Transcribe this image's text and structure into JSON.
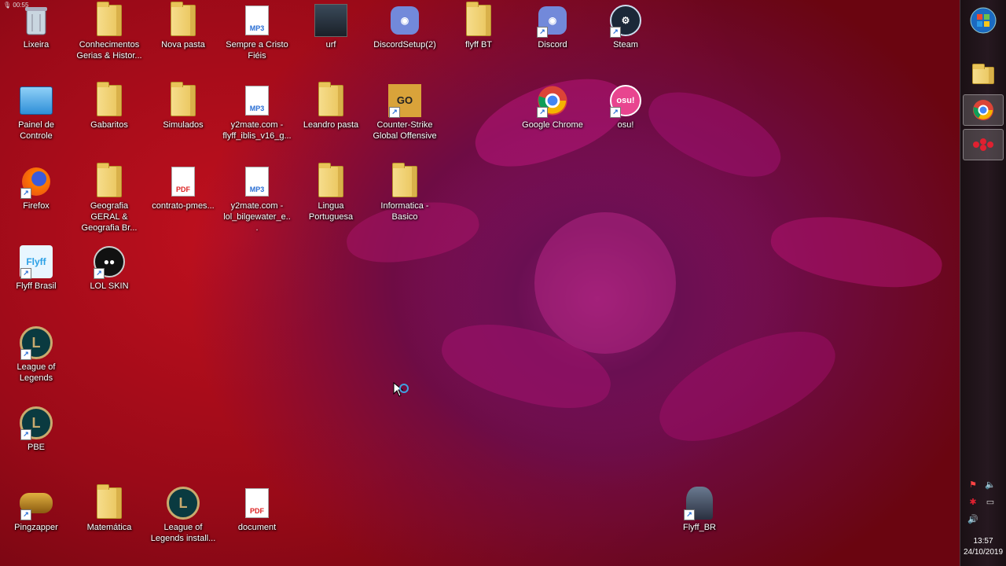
{
  "recorder": {
    "label": "00:55"
  },
  "desktop_icons": [
    {
      "name": "recycle-bin",
      "label": "Lixeira",
      "type": "bin"
    },
    {
      "name": "conhecimentos-folder",
      "label": "Conhecimentos Gerias & Histor...",
      "type": "folder"
    },
    {
      "name": "nova-pasta-folder",
      "label": "Nova pasta",
      "type": "folder"
    },
    {
      "name": "sempre-a-cristo-file",
      "label": "Sempre a Cristo Fiéis",
      "type": "mp3"
    },
    {
      "name": "urf-file",
      "label": "urf",
      "type": "image"
    },
    {
      "name": "discordsetup-file",
      "label": "DiscordSetup(2)",
      "type": "discord"
    },
    {
      "name": "flyff-bt-folder",
      "label": "flyff BT",
      "type": "folder"
    },
    {
      "name": "discord-shortcut",
      "label": "Discord",
      "type": "discord"
    },
    {
      "name": "steam-shortcut",
      "label": "Steam",
      "type": "steam"
    },
    {
      "name": "painel-de-controle",
      "label": "Painel de Controle",
      "type": "control"
    },
    {
      "name": "gabaritos-folder",
      "label": "Gabaritos",
      "type": "folder"
    },
    {
      "name": "simulados-folder",
      "label": "Simulados",
      "type": "folder"
    },
    {
      "name": "y2mate-flyff-file",
      "label": "y2mate.com - flyff_iblis_v16_g...",
      "type": "mp3"
    },
    {
      "name": "leandro-pasta-folder",
      "label": "Leandro pasta",
      "type": "folder"
    },
    {
      "name": "counter-strike-shortcut",
      "label": "Counter-Strike Global Offensive",
      "type": "csgo"
    },
    {
      "name": "google-chrome-shortcut",
      "label": "Google Chrome",
      "type": "chrome"
    },
    {
      "name": "osu-shortcut",
      "label": "osu!",
      "type": "osu"
    },
    {
      "name": "firefox-shortcut",
      "label": "Firefox",
      "type": "firefox"
    },
    {
      "name": "geografia-folder",
      "label": "Geografia GERAL & Geografia Br...",
      "type": "folder"
    },
    {
      "name": "contrato-pdf",
      "label": "contrato-pmes...",
      "type": "pdf"
    },
    {
      "name": "y2mate-lol-file",
      "label": "y2mate.com - lol_bilgewater_e...",
      "type": "mp3"
    },
    {
      "name": "lingua-portuguesa-folder",
      "label": "Lingua Portuguesa",
      "type": "folder"
    },
    {
      "name": "informatica-basico-folder",
      "label": "Informatica - Basico",
      "type": "folder"
    },
    {
      "name": "flyff-brasil-shortcut",
      "label": "Flyff Brasil",
      "type": "flyff"
    },
    {
      "name": "lol-skin-shortcut",
      "label": "LOL SKIN",
      "type": "lolskin"
    },
    {
      "name": "league-of-legends-shortcut",
      "label": "League of Legends",
      "type": "lol"
    },
    {
      "name": "pbe-shortcut",
      "label": "PBE",
      "type": "lol"
    },
    {
      "name": "pingzapper-shortcut",
      "label": "Pingzapper",
      "type": "ping"
    },
    {
      "name": "matematica-folder",
      "label": "Matemática",
      "type": "folder"
    },
    {
      "name": "lol-installer-file",
      "label": "League of Legends install...",
      "type": "lol"
    },
    {
      "name": "document-pdf",
      "label": "document",
      "type": "pdf"
    },
    {
      "name": "flyff-br-shortcut",
      "label": "Flyff_BR",
      "type": "flyffbr"
    }
  ],
  "taskbar": {
    "start_label": "Start",
    "clock_time": "13:57",
    "clock_date": "24/10/2019"
  }
}
